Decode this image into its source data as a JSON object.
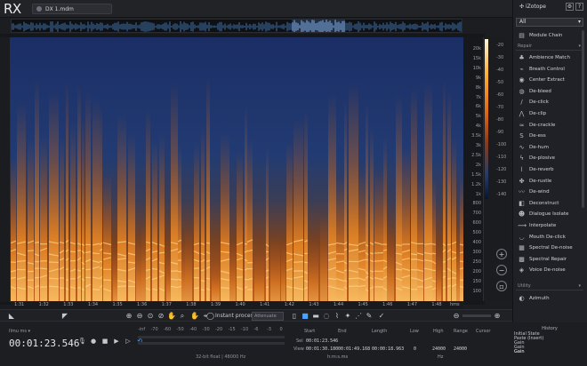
{
  "app": {
    "logo": "RX",
    "brand": "iZotope",
    "file_tab": "DX 1.mdm"
  },
  "freq_labels": [
    "20k",
    "15k",
    "10k",
    "9k",
    "8k",
    "7k",
    "6k",
    "5k",
    "4k",
    "3.5k",
    "3k",
    "2.5k",
    "2k",
    "1.5k",
    "1.2k",
    "1k",
    "800",
    "700",
    "600",
    "500",
    "400",
    "300",
    "250",
    "200",
    "150",
    "100"
  ],
  "db_labels": [
    "-20",
    "-30",
    "-40",
    "-50",
    "-60",
    "-70",
    "-80",
    "-90",
    "-100",
    "-110",
    "-120",
    "-130",
    "-140"
  ],
  "time_labels": [
    "1:31",
    "1:32",
    "1:33",
    "1:34",
    "1:35",
    "1:36",
    "1:37",
    "1:38",
    "1:39",
    "1:40",
    "1:41",
    "1:42",
    "1:43",
    "1:44",
    "1:45",
    "1:46",
    "1:47",
    "1:48",
    "hms"
  ],
  "toolbar": {
    "instant_process": "Instant process",
    "instant_option": "Attenuate"
  },
  "transport": {
    "timecode_label": "Ilmu ms ▾",
    "timecode": "00:01:23.546"
  },
  "meter": {
    "scale": [
      "-inf",
      "-70",
      "-60",
      "-50",
      "-40",
      "-30",
      "-20",
      "-15",
      "-10",
      "-6",
      "-3",
      "0"
    ],
    "caption": "32-bit float | 48000 Hz"
  },
  "selection": {
    "headers": [
      "Start",
      "End",
      "Length",
      "Low",
      "High",
      "Range",
      "Cursor"
    ],
    "sel_label": "Sel",
    "view_label": "View",
    "sel_start": "00:01:23.546",
    "view_start": "00:01:30.180",
    "view_end": "00:01:49.168",
    "view_length": "00:00:18.963",
    "low": "0",
    "high": "24000",
    "range": "24000",
    "hms": "h:m:s.ms",
    "hz": "Hz"
  },
  "history": {
    "title": "History",
    "items": [
      "Initial State",
      "Paste (Insert)",
      "Gain",
      "Gain",
      "Gain"
    ]
  },
  "panel": {
    "filter": "All",
    "section_repair": "Repair",
    "section_utility": "Utility",
    "modules": [
      {
        "label": "Module Chain",
        "icon": "chain-icon"
      },
      {
        "label": "Ambience Match",
        "icon": "ambience-icon"
      },
      {
        "label": "Breath Control",
        "icon": "breath-icon"
      },
      {
        "label": "Center Extract",
        "icon": "center-icon"
      },
      {
        "label": "De-bleed",
        "icon": "debleed-icon"
      },
      {
        "label": "De-click",
        "icon": "declick-icon"
      },
      {
        "label": "De-clip",
        "icon": "declip-icon"
      },
      {
        "label": "De-crackle",
        "icon": "decrackle-icon"
      },
      {
        "label": "De-ess",
        "icon": "deess-icon"
      },
      {
        "label": "De-hum",
        "icon": "dehum-icon"
      },
      {
        "label": "De-plosive",
        "icon": "deplosive-icon"
      },
      {
        "label": "De-reverb",
        "icon": "dereverb-icon"
      },
      {
        "label": "De-rustle",
        "icon": "derustle-icon"
      },
      {
        "label": "De-wind",
        "icon": "dewind-icon"
      },
      {
        "label": "Deconstruct",
        "icon": "deconstruct-icon"
      },
      {
        "label": "Dialogue Isolate",
        "icon": "dialogue-icon"
      },
      {
        "label": "Interpolate",
        "icon": "interpolate-icon"
      },
      {
        "label": "Mouth De-click",
        "icon": "mouth-icon"
      },
      {
        "label": "Spectral De-noise",
        "icon": "spectral-denoise-icon"
      },
      {
        "label": "Spectral Repair",
        "icon": "spectral-repair-icon"
      },
      {
        "label": "Voice De-noise",
        "icon": "voice-denoise-icon"
      }
    ],
    "utility_modules": [
      {
        "label": "Azimuth",
        "icon": "azimuth-icon"
      }
    ]
  }
}
